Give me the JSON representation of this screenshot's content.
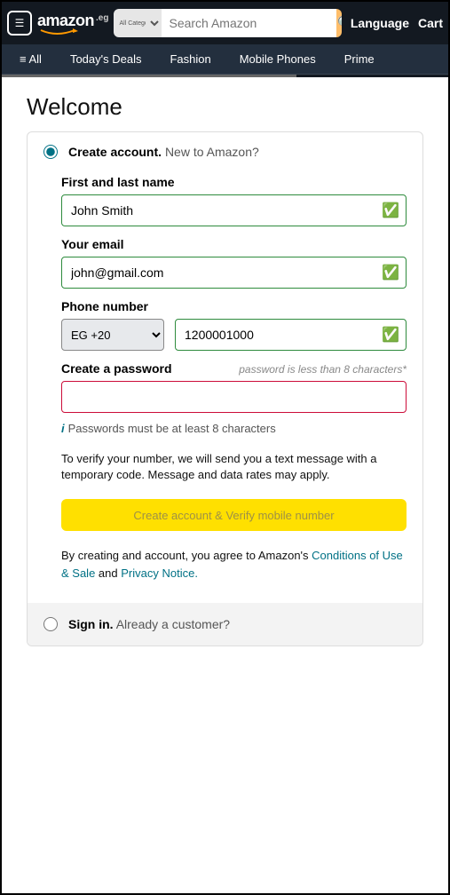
{
  "header": {
    "hamburger": "☰",
    "logo_word": "amazon",
    "logo_tld": ".eg",
    "category_opt": "All Categori",
    "search_placeholder": "Search Amazon",
    "language": "Language",
    "cart": "Cart"
  },
  "nav": {
    "all": "≡ All",
    "deals": "Today's Deals",
    "fashion": "Fashion",
    "mobile": "Mobile Phones",
    "prime": "Prime"
  },
  "page": {
    "title": "Welcome",
    "create_head": "Create account.",
    "create_sub": "New to Amazon?",
    "name_label": "First and last name",
    "name_value": "John Smith",
    "email_label": "Your email",
    "email_value": "john@gmail.com",
    "phone_label": "Phone number",
    "cc_value": "EG +20",
    "phone_value": "1200001000",
    "pw_label": "Create a password",
    "pw_hint_right": "password is less than 8 characters*",
    "pw_value": "",
    "pw_hint_bottom": "Passwords must be at least 8 characters",
    "verify_text": "To verify your number, we will send you a text message with a temporary code. Message and data rates may apply.",
    "submit": "Create account & Verify mobile number",
    "legal_pre": "By creating and account, you agree to Amazon's ",
    "legal_link1": "Conditions of Use & Sale",
    "legal_mid": " and ",
    "legal_link2": "Privacy Notice.",
    "signin_head": "Sign in.",
    "signin_sub": "Already a customer?",
    "check_glyph": "✅",
    "i_glyph": "i"
  }
}
